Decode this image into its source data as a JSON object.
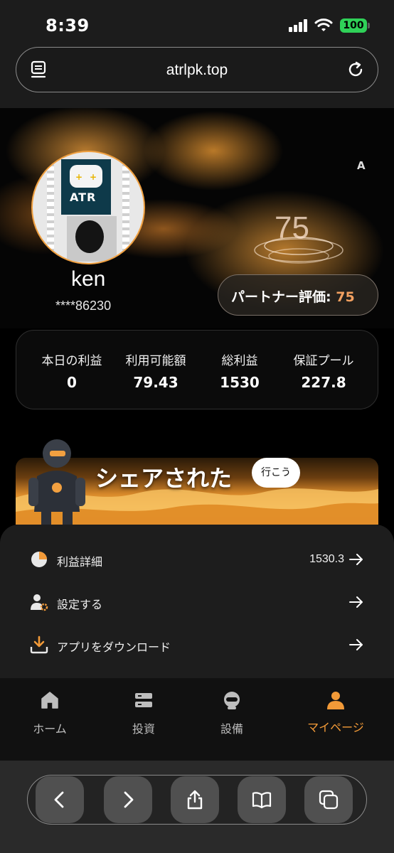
{
  "status_bar": {
    "time": "8:39",
    "battery": "100"
  },
  "browser": {
    "url": "atrlpk.top"
  },
  "hero": {
    "corner_mark": "A",
    "score_display": "75",
    "username": "ken",
    "user_id": "****86230",
    "partner_label": "パートナー評価: ",
    "partner_score": "75",
    "avatar_brand": "ATR"
  },
  "stats": [
    {
      "label": "本日の利益",
      "value": "0"
    },
    {
      "label": "利用可能額",
      "value": "79.43"
    },
    {
      "label": "総利益",
      "value": "1530"
    },
    {
      "label": "保証プール",
      "value": "227.8"
    }
  ],
  "share": {
    "title": "シェアされた",
    "button": "行こう"
  },
  "menu": [
    {
      "icon": "pie-chart-icon",
      "label": "利益詳細",
      "value": "1530.3"
    },
    {
      "icon": "user-gear-icon",
      "label": "設定する",
      "value": ""
    },
    {
      "icon": "download-icon",
      "label": "アプリをダウンロード",
      "value": ""
    }
  ],
  "nav": [
    {
      "icon": "home-icon",
      "label": "ホーム",
      "active": false
    },
    {
      "icon": "server-icon",
      "label": "投資",
      "active": false
    },
    {
      "icon": "robot-icon",
      "label": "設備",
      "active": false
    },
    {
      "icon": "profile-icon",
      "label": "マイページ",
      "active": true
    }
  ],
  "colors": {
    "accent": "#f29a38",
    "battery": "#2fd158"
  }
}
